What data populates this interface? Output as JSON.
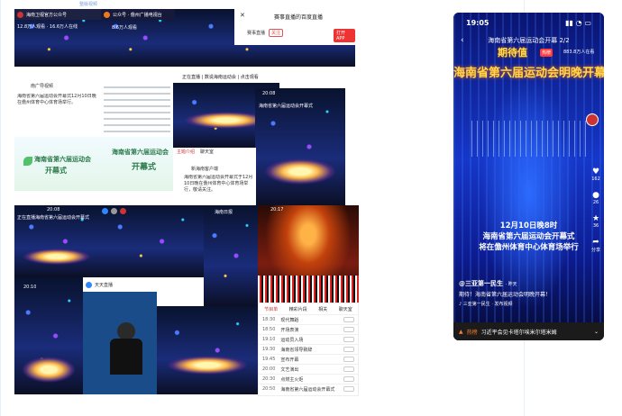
{
  "top_label": "整版视频",
  "collage": {
    "tile1": {
      "account": "海南卫视官方公众号",
      "meta": "12.8万人观看 · 16.6万人在线"
    },
    "tile2": {
      "account": "公众号 · 儋州广播电视台",
      "meta": "8.6万人观看"
    },
    "tile3": {
      "title": "赛事直播的百度直播",
      "account": "赛事直播",
      "follow": "关注",
      "btn": "打开APP"
    },
    "tile4": {
      "account": "南广导视频",
      "text": "海南省第六届运动会开幕式12月10日晚在儋州体育中心体育场举行。"
    },
    "tile5": {
      "title": "正在直播 | 数说海南运动会 | 点击观看"
    },
    "tile6": {
      "time": "20:08",
      "title": "海南省第六届运动会开幕式"
    },
    "poster1": {
      "text": "海南省第六届运动会",
      "sub": "开幕式"
    },
    "poster2": {
      "text": "海南省第六届运动会",
      "sub": "开幕式"
    },
    "tile7": {
      "tabs": [
        "主题介绍",
        "聊天室"
      ],
      "account": "新海南客户端",
      "text": "海南省第六届运动会开幕式于12月10日晚在儋州体育中心体育场举行，敬请关注。"
    },
    "tile8": {
      "time": "20:08",
      "title": "正在直播海南省第六届运动会开幕式"
    },
    "tile9": {
      "account": "海南日报"
    },
    "tile10": {
      "time": "20:17"
    },
    "tile11": {
      "time": "20:10"
    },
    "tile12": {
      "account": "天天直播"
    },
    "schedule": {
      "tabs": [
        "节目单",
        "精彩片段",
        "相关",
        "聊天室"
      ],
      "rows": [
        {
          "time": "18:30",
          "name": "现代舞蹈"
        },
        {
          "time": "18:50",
          "name": "开场表演"
        },
        {
          "time": "19:10",
          "name": "运动员入场"
        },
        {
          "time": "19:30",
          "name": "海南省领导致辞"
        },
        {
          "time": "19:45",
          "name": "宣布开幕"
        },
        {
          "time": "20:00",
          "name": "文艺演出"
        },
        {
          "time": "20:30",
          "name": "点燃主火炬"
        },
        {
          "time": "20:50",
          "name": "海南省第六届运动会开幕式"
        }
      ]
    }
  },
  "phone": {
    "time": "19:05",
    "title": "海南省第六届运动会开幕 2/2",
    "badge_big": "期待值",
    "hot": "热榜",
    "viewers": "883.8万人在看",
    "headline": "海南省第六届运动会明晚开幕",
    "caption_lines": [
      "12月10日晚8时",
      "海南省第六届运动会开幕式",
      "将在儋州体育中心体育场举行"
    ],
    "author": "@三亚第一民生",
    "author_time": "· 昨天",
    "desc": "期待！海南省第六届运动会明晚开幕！",
    "music": "三亚第一民生 · 发布视频",
    "side": [
      {
        "icon": "heart",
        "count": "162"
      },
      {
        "icon": "comment",
        "count": "26"
      },
      {
        "icon": "star",
        "count": "36"
      },
      {
        "icon": "share",
        "count": "分享"
      }
    ],
    "bottom_hot": "热榜",
    "bottom_text": "习近平会见卡塔尔埃米尔塔米姆"
  }
}
